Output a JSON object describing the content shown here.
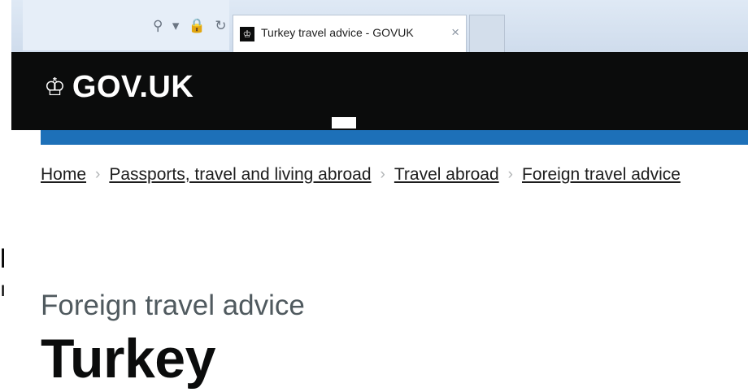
{
  "browser": {
    "tab_title": "Turkey travel advice - GOVUK",
    "tab_close": "×",
    "address_controls": "⚲ ▾ 🔒 ↻"
  },
  "header": {
    "logo_crown": "♔",
    "logo_text": "GOV.UK"
  },
  "breadcrumbs": [
    {
      "label": "Home"
    },
    {
      "label": "Passports, travel and living abroad"
    },
    {
      "label": "Travel abroad"
    },
    {
      "label": "Foreign travel advice"
    }
  ],
  "breadcrumb_separator": "›",
  "edge_text": {
    "line1": "l",
    "line2": "ı"
  },
  "page": {
    "caption": "Foreign travel advice",
    "title": "Turkey"
  },
  "colors": {
    "header_bg": "#0b0c0c",
    "accent_blue": "#1d70b8"
  }
}
